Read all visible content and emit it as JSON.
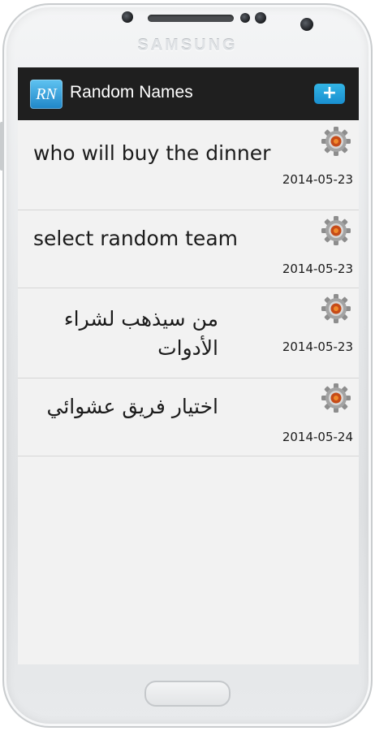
{
  "device": {
    "brand": "SAMSUNG"
  },
  "action_bar": {
    "logo_text": "RN",
    "title": "Random Names",
    "add_label": "+"
  },
  "items": [
    {
      "title": "who will buy the dinner",
      "date": "2014-05-23",
      "icon": "gear-icon"
    },
    {
      "title": "select random team",
      "date": "2014-05-23",
      "icon": "gear-icon"
    },
    {
      "title": "من سيذهب لشراء الأدوات",
      "date": "2014-05-23",
      "icon": "gear-icon"
    },
    {
      "title": "اختيار فريق عشوائي",
      "date": "2014-05-24",
      "icon": "gear-icon"
    }
  ],
  "colors": {
    "action_bar": "#1f1f1f",
    "accent": "#33b5e5",
    "list_background": "#f2f2f2"
  }
}
